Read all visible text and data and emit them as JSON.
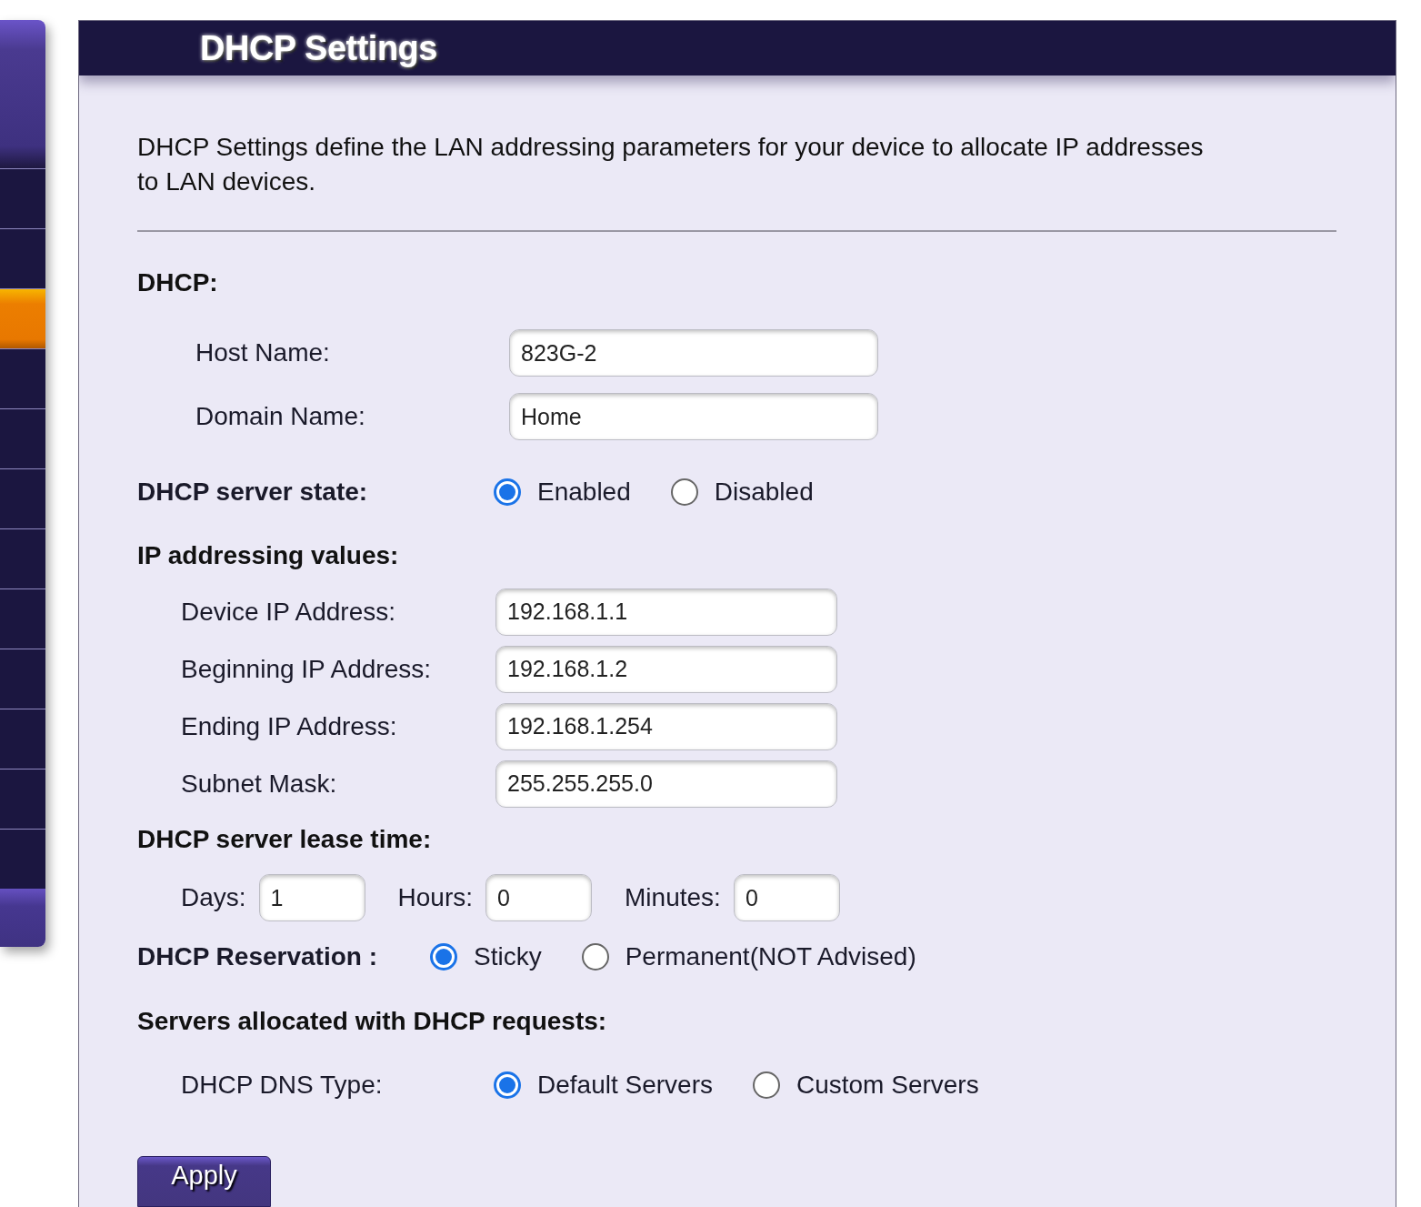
{
  "sidebar": {
    "items": [
      {
        "selected": false
      },
      {
        "selected": false
      },
      {
        "selected": true
      },
      {
        "selected": false
      },
      {
        "selected": false
      },
      {
        "selected": false
      },
      {
        "selected": false
      },
      {
        "selected": false
      },
      {
        "selected": false
      },
      {
        "selected": false
      },
      {
        "selected": false
      },
      {
        "selected": false
      }
    ]
  },
  "panel_title": "DHCP Settings",
  "description": "DHCP Settings define the LAN addressing parameters for your device to allocate IP addresses to LAN devices.",
  "dhcp": {
    "heading": "DHCP:",
    "fields": [
      {
        "label": "Host Name:",
        "value": "823G-2"
      },
      {
        "label": "Domain Name:",
        "value": "Home"
      }
    ]
  },
  "server_state": {
    "label": "DHCP server state:",
    "options": [
      {
        "label": "Enabled",
        "selected": true
      },
      {
        "label": "Disabled",
        "selected": false
      }
    ]
  },
  "ip_addressing": {
    "heading": "IP addressing values:",
    "fields": [
      {
        "label": "Device IP Address:",
        "value": "192.168.1.1"
      },
      {
        "label": "Beginning IP Address:",
        "value": "192.168.1.2"
      },
      {
        "label": "Ending IP Address:",
        "value": "192.168.1.254"
      },
      {
        "label": "Subnet Mask:",
        "value": "255.255.255.0"
      }
    ]
  },
  "lease_time": {
    "heading": "DHCP server lease time:",
    "fields": [
      {
        "label": "Days:",
        "value": "1"
      },
      {
        "label": "Hours:",
        "value": "0"
      },
      {
        "label": "Minutes:",
        "value": "0"
      }
    ]
  },
  "reservation": {
    "label": "DHCP Reservation :",
    "options": [
      {
        "label": "Sticky",
        "selected": true
      },
      {
        "label": "Permanent(NOT Advised)",
        "selected": false
      }
    ]
  },
  "servers": {
    "heading": "Servers allocated with DHCP requests:",
    "dns_type": {
      "label": "DHCP DNS Type:",
      "options": [
        {
          "label": "Default Servers",
          "selected": true
        },
        {
          "label": "Custom Servers",
          "selected": false
        }
      ]
    }
  },
  "apply_button": "Apply"
}
